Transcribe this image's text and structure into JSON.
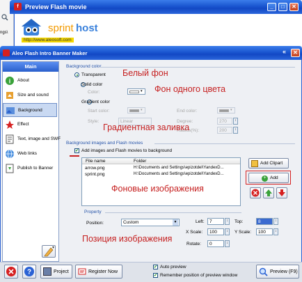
{
  "browser": {
    "left_text": "ngs\\",
    "left_text2": "ng"
  },
  "preview_window": {
    "title": "Preview Flash movie",
    "banner_logo_text": "sprint",
    "banner_logo_text2": "host",
    "banner_url": "http://www.aleosoft.com"
  },
  "main_window": {
    "title": "Aleo Flash Intro Banner Maker"
  },
  "sidebar": {
    "header": "Main",
    "items": [
      {
        "label": "About",
        "icon": "about-icon"
      },
      {
        "label": "Size and sound",
        "icon": "size-sound-icon"
      },
      {
        "label": "Background",
        "icon": "background-icon",
        "selected": true
      },
      {
        "label": "Effect",
        "icon": "effect-icon"
      },
      {
        "label": "Text, image and SWF",
        "icon": "text-image-icon"
      },
      {
        "label": "Web links",
        "icon": "web-links-icon"
      },
      {
        "label": "Publish to Banner",
        "icon": "publish-icon"
      }
    ]
  },
  "background_color": {
    "group_title": "Background color",
    "transparent": "Transparent",
    "solid": "Solid color",
    "color_label": "Color:",
    "gradient": "Gradient color",
    "start_color": "Start color:",
    "end_color": "End color:",
    "style_label": "Style:",
    "style_value": "Linear",
    "degree_label": "Degree:",
    "degree_value": "270",
    "radius_label": "Radius(%):",
    "radius_value": "200"
  },
  "images": {
    "group_title": "Background images and Flash movies",
    "checkbox_label": "Add images and Flash movies to background",
    "col_file": "File name",
    "col_folder": "Folder",
    "rows": [
      {
        "file": "arrow.png",
        "folder": "H:\\Documents and Settings\\epizotdel\\YandexD..."
      },
      {
        "file": "sprint.png",
        "folder": "H:\\Documents and Settings\\epizotdel\\YandexD..."
      }
    ],
    "add_clipart": "Add Clipart",
    "add": "Add"
  },
  "property": {
    "group_title": "Property",
    "position_label": "Position:",
    "position_value": "Custom",
    "left_label": "Left:",
    "left_value": "7",
    "top_label": "Top:",
    "top_value": "8",
    "xscale_label": "X Scale:",
    "xscale_value": "100",
    "yscale_label": "Y Scale:",
    "yscale_value": "100",
    "rotate_label": "Rotate:",
    "rotate_value": "0"
  },
  "annotations": {
    "white_bg": "Белый фон",
    "solid_bg": "Фон одного цвета",
    "gradient_fill": "Градиентная заливка",
    "bg_images": "Фоновые изображения",
    "image_position": "Позиция изображения"
  },
  "footer": {
    "project": "Project",
    "register": "Register Now",
    "auto_preview": "Auto preview",
    "remember_preview": "Remember position of preview window",
    "preview": "Preview (F9)"
  },
  "colors": {
    "accent_blue": "#1a56d0",
    "annotation_red": "#c62020",
    "banner_yellow": "#f5b800"
  }
}
